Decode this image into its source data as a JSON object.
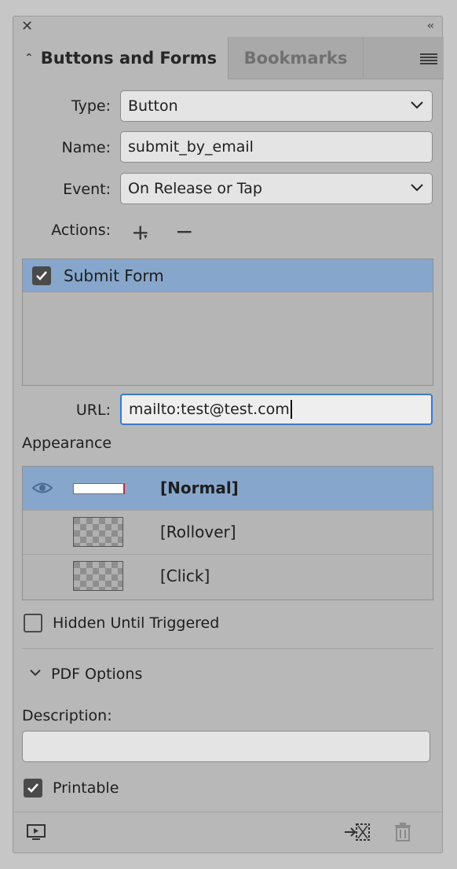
{
  "tabs": {
    "active": "Buttons and Forms",
    "inactive": "Bookmarks"
  },
  "form": {
    "type_label": "Type:",
    "type_value": "Button",
    "name_label": "Name:",
    "name_value": "submit_by_email",
    "event_label": "Event:",
    "event_value": "On Release or Tap",
    "actions_label": "Actions:",
    "url_label": "URL:",
    "url_value": "mailto:test@test.com"
  },
  "actions": [
    {
      "label": "Submit Form",
      "checked": true
    }
  ],
  "appearance": {
    "title": "Appearance",
    "states": [
      {
        "label": "[Normal]",
        "selected": true,
        "visible": true
      },
      {
        "label": "[Rollover]",
        "selected": false,
        "visible": false
      },
      {
        "label": "[Click]",
        "selected": false,
        "visible": false
      }
    ]
  },
  "hidden_until_triggered": {
    "label": "Hidden Until Triggered",
    "checked": false
  },
  "pdf_options": {
    "title": "PDF Options",
    "description_label": "Description:",
    "description_value": "",
    "printable_label": "Printable",
    "printable_checked": true
  },
  "colors": {
    "selection": "#87a6cc",
    "focus": "#3a7ac8",
    "panel": "#b8b8b8"
  },
  "icons": [
    "close-icon",
    "collapse-icon",
    "panel-menu-icon",
    "dropdown-chevron-icon",
    "add-action-icon",
    "remove-action-icon",
    "eye-icon",
    "preview-icon",
    "convert-to-object-icon",
    "trash-icon"
  ]
}
